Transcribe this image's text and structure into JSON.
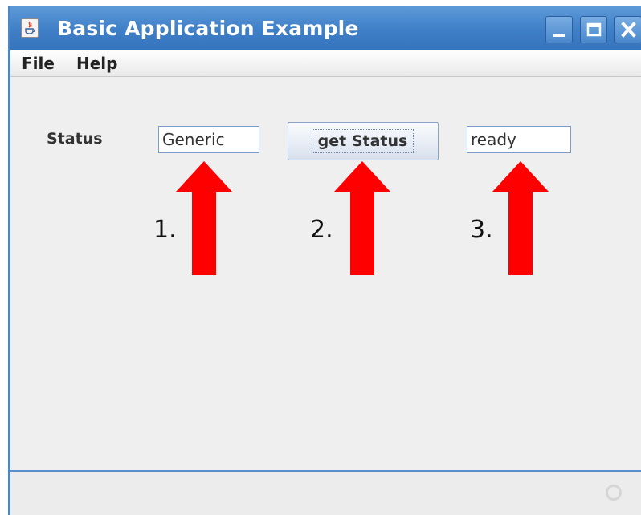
{
  "window": {
    "title": "Basic Application Example",
    "icon": "java-app-icon",
    "controls": [
      "minimize-icon",
      "maximize-icon",
      "close-icon"
    ],
    "accent_color": "#3f7fc7"
  },
  "menu": {
    "items": [
      "File",
      "Help"
    ]
  },
  "form": {
    "status_label": "Status",
    "input_value": "Generic",
    "button_label": "get Status",
    "output_value": "ready"
  },
  "annotations": {
    "arrow_color": "#ff0000",
    "steps": [
      "1.",
      "2.",
      "3."
    ]
  }
}
